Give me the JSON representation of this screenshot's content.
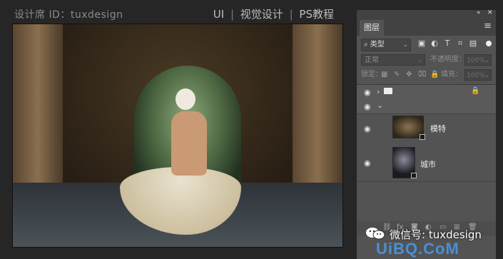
{
  "topbar": {
    "designer_id": "设计席 ID：tuxdesign",
    "right_items": [
      "UI",
      "视觉设计",
      "PS教程"
    ],
    "separator": "|"
  },
  "panel": {
    "collapse_glyph": "«",
    "close_glyph": "✕",
    "tab_label": "图层",
    "menu_glyph": "≡",
    "filter": {
      "kind_label": "类型",
      "search_glyph": "⌕",
      "chevron": "⌄"
    },
    "blend_mode": "正常",
    "opacity_label": "不透明度：",
    "opacity_value": "100%",
    "lock_label": "锁定：",
    "fill_label": "填充：",
    "fill_value": "100%",
    "layers": [
      {
        "type": "group",
        "eye": "◉",
        "expander": "›",
        "locked": true
      },
      {
        "type": "subgroup",
        "eye": "◉",
        "expander": "⌄"
      },
      {
        "name": "模特",
        "eye": "◉"
      },
      {
        "name": "城市",
        "eye": "◉"
      }
    ]
  },
  "watermarks": {
    "wechat": "微信号: tuxdesign",
    "site": "UiBQ.CoM"
  },
  "colors": {
    "app_bg": "#262626",
    "panel_bg": "#535353",
    "tab_bar_bg": "#424242",
    "site_blue": "#4a8fd6"
  }
}
